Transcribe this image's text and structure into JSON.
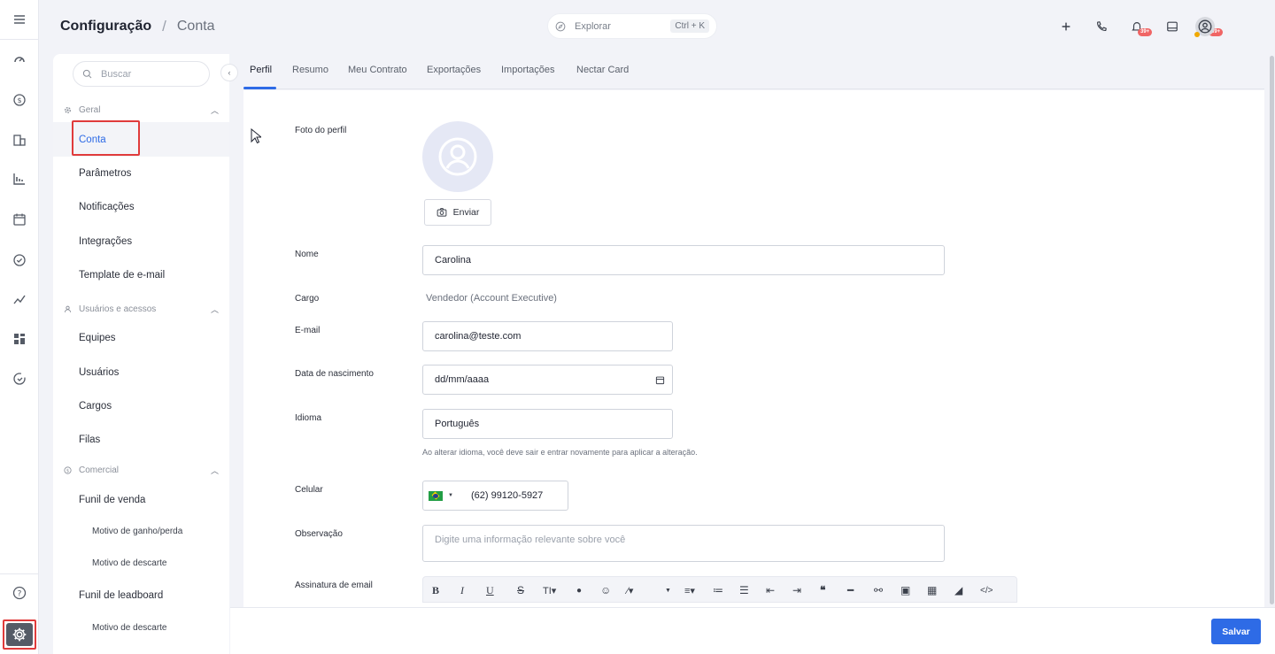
{
  "header": {
    "breadcrumb_root": "Configuração",
    "breadcrumb_sep": "/",
    "breadcrumb_current": "Conta",
    "explore_placeholder": "Explorar",
    "explore_shortcut": "Ctrl + K",
    "badge_alerts": "39+",
    "badge_tasks": "39+"
  },
  "rail": {
    "icons": [
      "menu-icon",
      "dashboard-gauge-icon",
      "dollar-icon",
      "building-icon",
      "chart-icon",
      "calendar-icon",
      "check-circle-icon",
      "activity-icon",
      "widgets-icon",
      "sync-icon",
      "help-icon",
      "gear-icon"
    ]
  },
  "sidebar": {
    "search_placeholder": "Buscar",
    "sections": {
      "geral": "Geral",
      "usuarios": "Usuários e acessos",
      "comercial": "Comercial"
    },
    "items": {
      "conta": "Conta",
      "parametros": "Parâmetros",
      "notificacoes": "Notificações",
      "integracoes": "Integrações",
      "template": "Template de e-mail",
      "equipes": "Equipes",
      "usuarios": "Usuários",
      "cargos": "Cargos",
      "filas": "Filas",
      "funil_venda": "Funil de venda",
      "motivo_ganho": "Motivo de ganho/perda",
      "motivo_descarte": "Motivo de descarte",
      "funil_leadboard": "Funil de leadboard",
      "motivo_descarte_2": "Motivo de descarte"
    }
  },
  "tabs": [
    "Perfil",
    "Resumo",
    "Meu Contrato",
    "Exportações",
    "Importações",
    "Nectar Card"
  ],
  "form": {
    "photo_label": "Foto do perfil",
    "send_button": "Enviar",
    "name_label": "Nome",
    "name_value": "Carolina",
    "role_label": "Cargo",
    "role_value": "Vendedor (Account Executive)",
    "email_label": "E-mail",
    "email_value": "carolina@teste.com",
    "birth_label": "Data de nascimento",
    "birth_value": "dd/mm/aaaa",
    "lang_label": "Idioma",
    "lang_value": "Português",
    "lang_hint": "Ao alterar idioma, você deve sair e entrar novamente para aplicar a alteração.",
    "phone_label": "Celular",
    "phone_value": "(62) 99120-5927",
    "obs_label": "Observação",
    "obs_placeholder": "Digite uma informação relevante sobre você",
    "signature_label": "Assinatura de email"
  },
  "footer": {
    "save_button": "Salvar"
  },
  "colors": {
    "accent": "#2e6be6",
    "highlight_box": "#e03b3b",
    "badge": "#f06565"
  }
}
